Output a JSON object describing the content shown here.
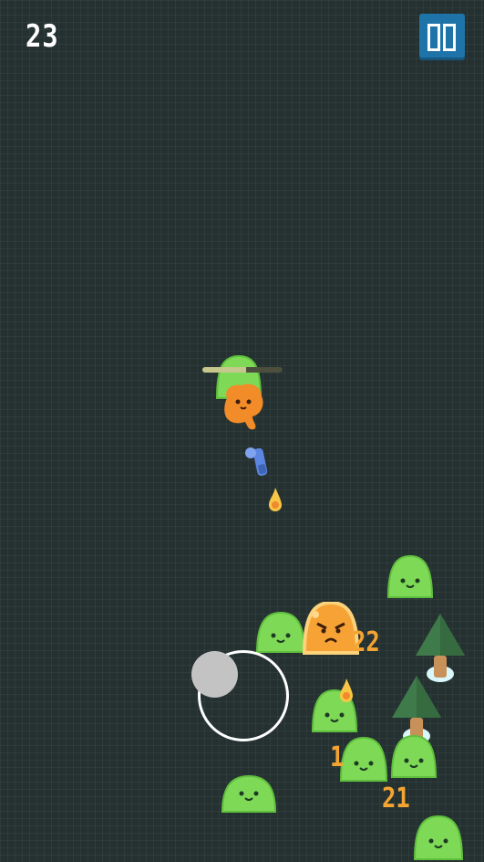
{
  "hud": {
    "score": "23",
    "pause_icon": "pause-icon"
  },
  "player": {
    "health": 0.55
  },
  "damage_numbers": [
    "22",
    "1",
    "21"
  ],
  "colors": {
    "background": "#253131",
    "slime_green": "#7ed957",
    "angry_slime": "#f6a235",
    "player": "#f28c28",
    "pause_button": "#1e74a8",
    "damage_text": "#f4a431",
    "tree": "#3f7a4a"
  }
}
